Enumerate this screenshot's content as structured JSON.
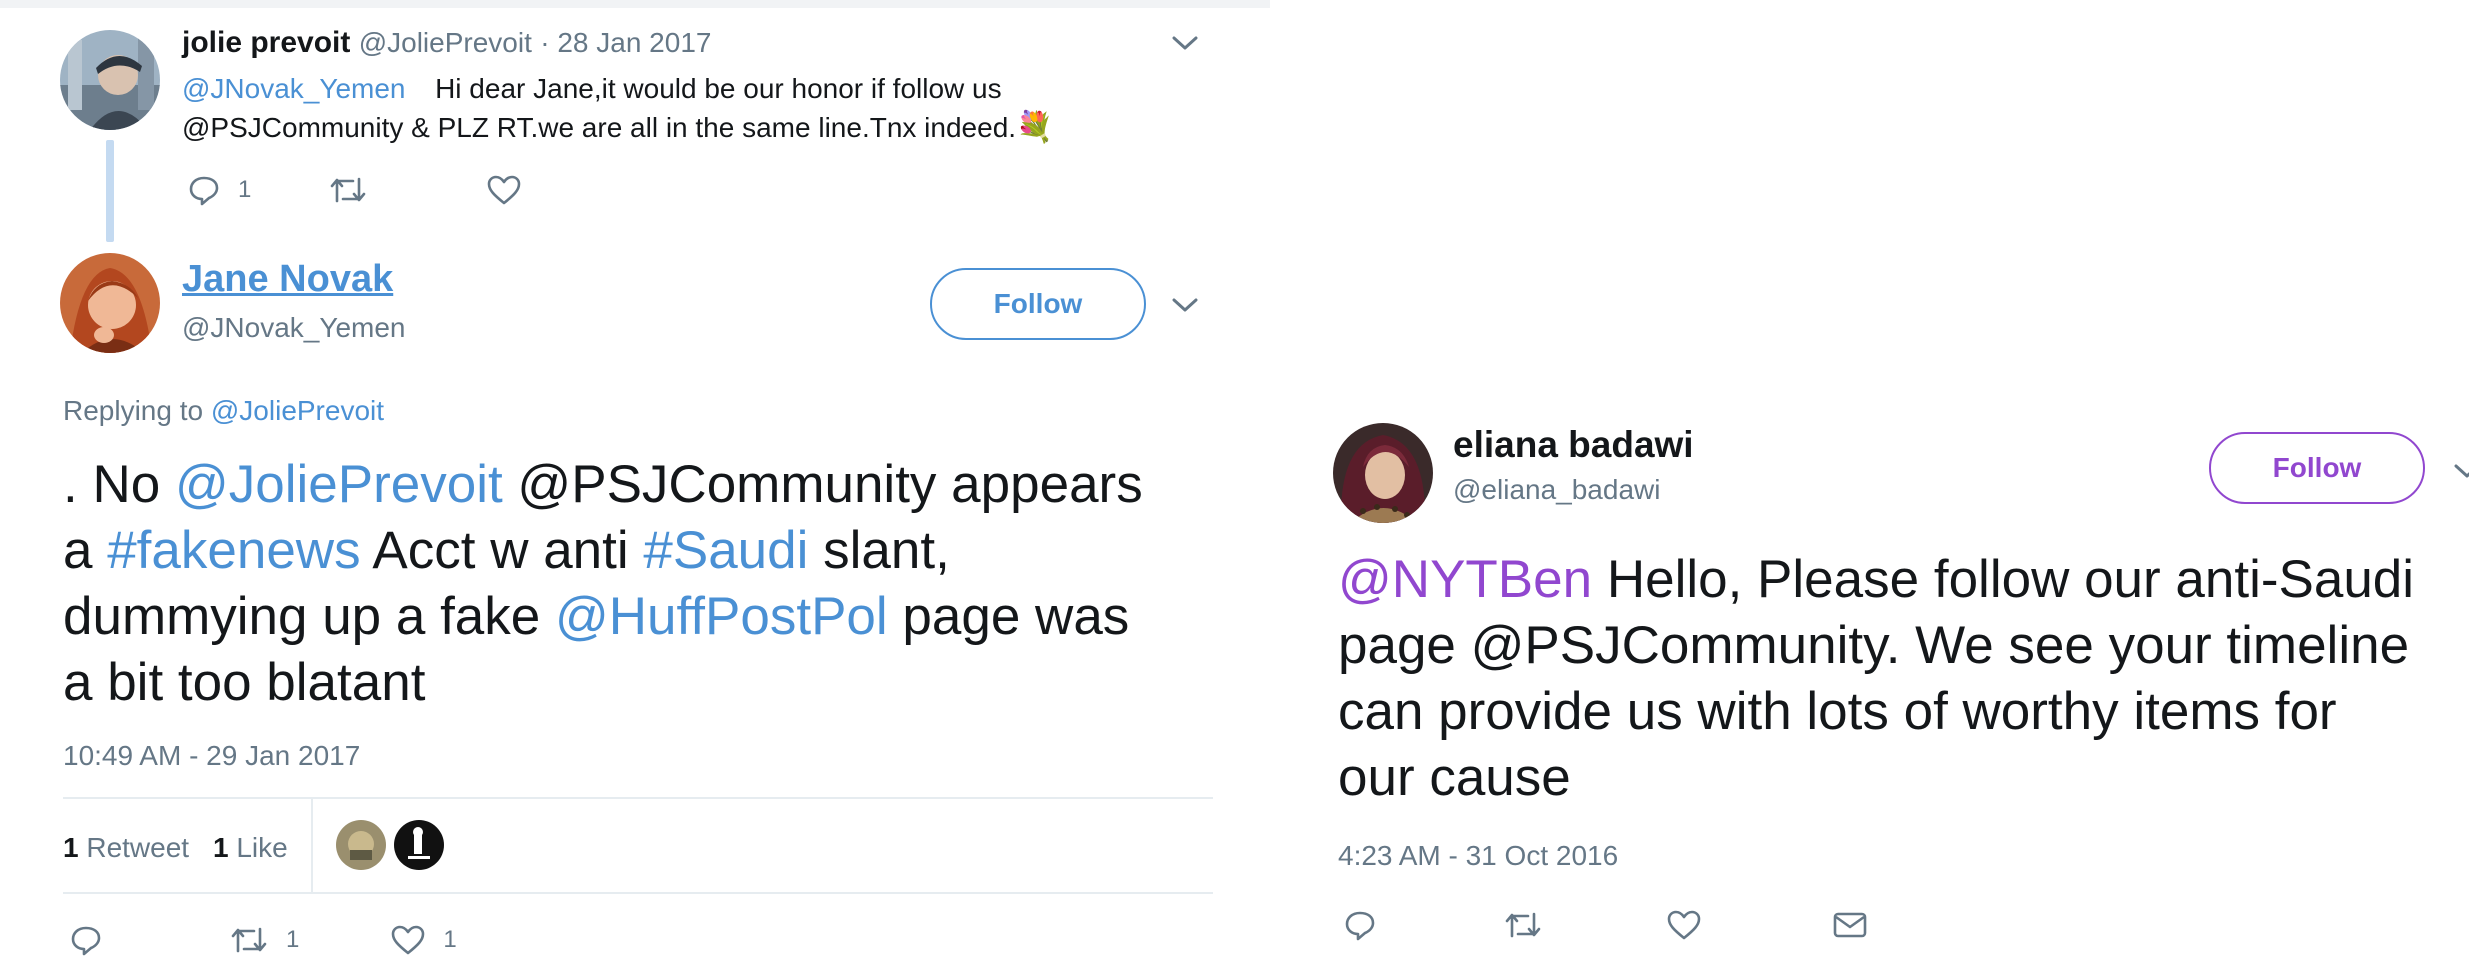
{
  "colors": {
    "link_blue": "#4a90d4",
    "link_purple": "#9147cf",
    "text_dark": "#14171a",
    "text_grey": "#657786",
    "thread_line": "#c4daf1",
    "divider": "#e6ecf0"
  },
  "left": {
    "reply_tweet": {
      "author_name": "jolie prevoit",
      "author_handle": "@JoliePrevoit",
      "date": "· 28 Jan 2017",
      "mention": "@JNovak_Yemen",
      "line1": "Hi dear Jane,it would be our honor if follow us",
      "line2": "@PSJCommunity & PLZ RT.we are all in the same line.Tnx indeed.",
      "emoji": "💐",
      "reply_count": "1",
      "icons": [
        "reply-icon",
        "retweet-icon",
        "like-icon",
        "chevron-down-icon"
      ]
    },
    "main_tweet": {
      "author_name": "Jane Novak",
      "author_handle": "@JNovak_Yemen",
      "follow_label": "Follow",
      "replying_prefix": "Replying to",
      "replying_to": "@JoliePrevoit",
      "body": {
        "l1_a": ". No ",
        "l1_mention": "@JoliePrevoit",
        "l1_b": " @PSJCommunity appears",
        "l2_a": "a ",
        "l2_hashtag1": "#fakenews",
        "l2_b": " Acct w anti ",
        "l2_hashtag2": "#Saudi",
        "l2_c": " slant,",
        "l3_a": "dummying up a fake ",
        "l3_mention": "@HuffPostPol",
        "l3_b": " page was",
        "l4": "a bit too blatant"
      },
      "timestamp": "10:49 AM - 29 Jan 2017",
      "retweet_count": "1",
      "retweet_label": "Retweet",
      "like_count": "1",
      "like_label": "Like",
      "bottom_retweet_count": "1",
      "bottom_like_count": "1"
    }
  },
  "right": {
    "tweet": {
      "author_name": "eliana badawi",
      "author_handle": "@eliana_badawi",
      "follow_label": "Follow",
      "body": {
        "l1_mention": "@NYTBen",
        "l1_b": " Hello, Please follow our anti-Saudi",
        "l2": "page @PSJCommunity. We see your timeline",
        "l3": "can provide us with lots of worthy items for",
        "l4": "our cause"
      },
      "timestamp": "4:23 AM - 31 Oct 2016",
      "icons": [
        "reply-icon",
        "retweet-icon",
        "like-icon",
        "mail-icon",
        "chevron-down-icon"
      ]
    }
  }
}
